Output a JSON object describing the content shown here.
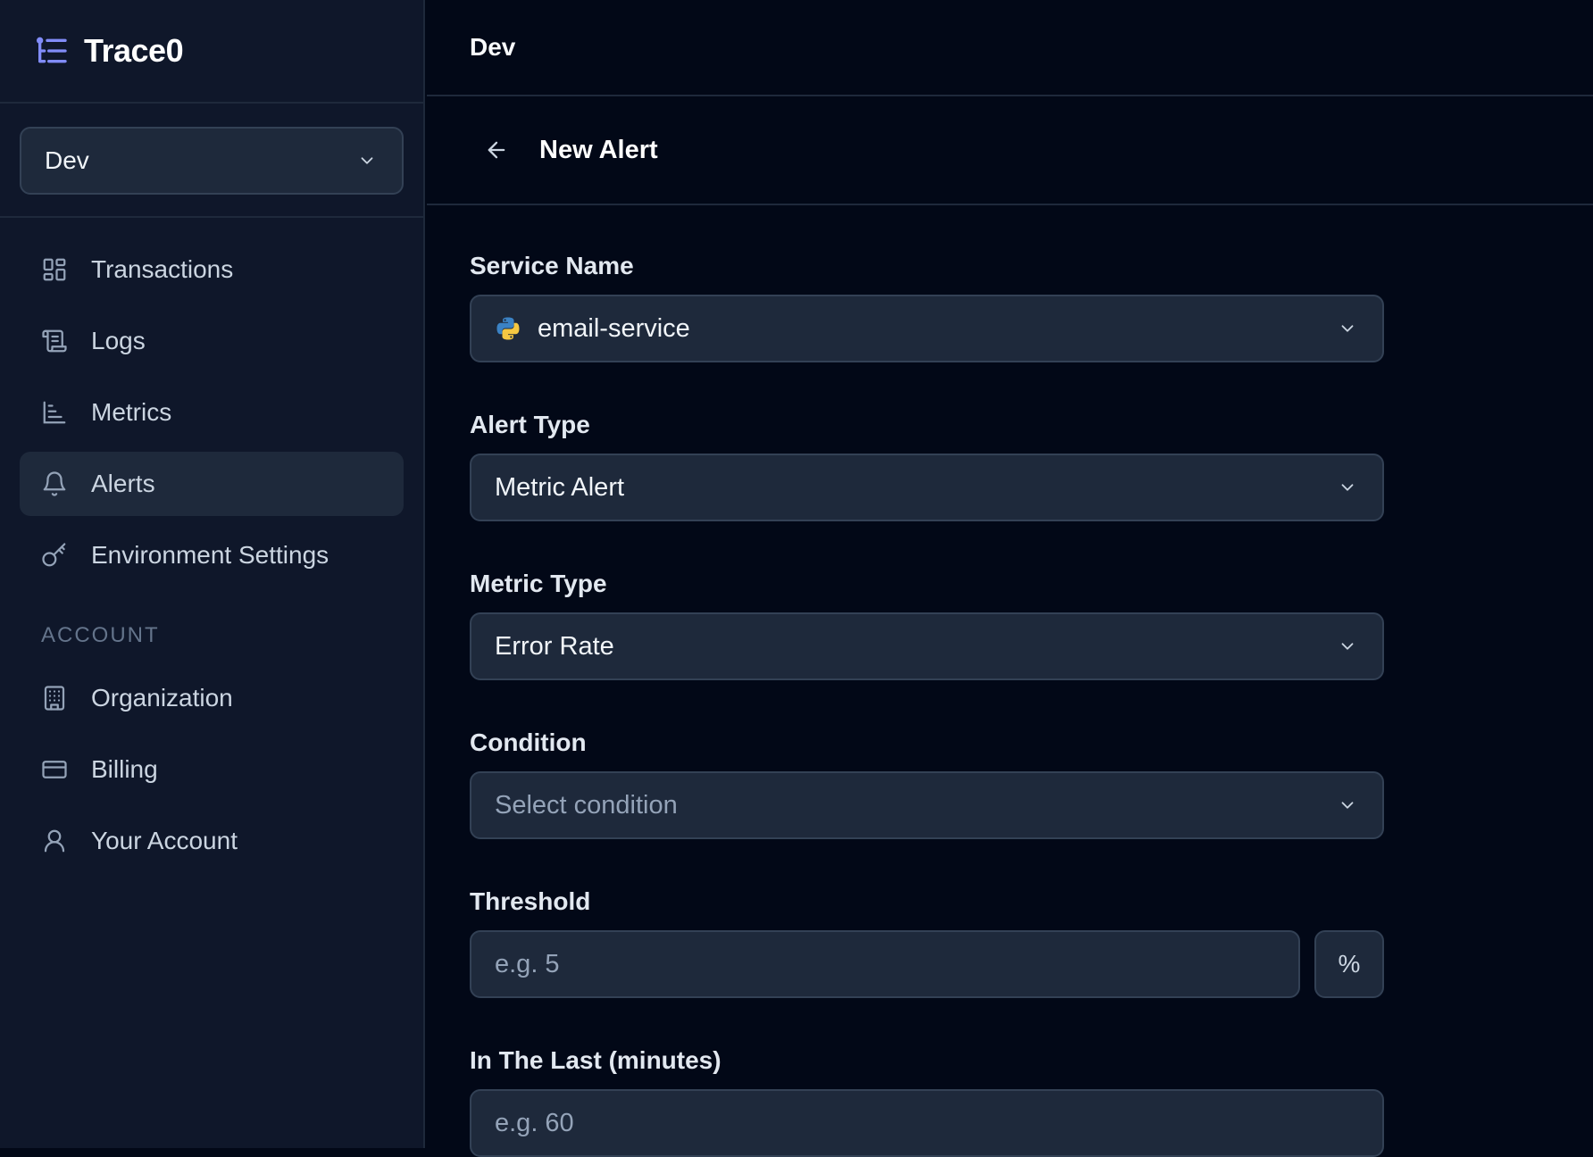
{
  "brand": {
    "name": "Trace0",
    "icon": "list-tree-icon"
  },
  "environment_selector": {
    "value": "Dev"
  },
  "nav": {
    "items": [
      {
        "label": "Transactions",
        "icon": "layout-grid-icon",
        "active": false
      },
      {
        "label": "Logs",
        "icon": "scroll-icon",
        "active": false
      },
      {
        "label": "Metrics",
        "icon": "bar-chart-icon",
        "active": false
      },
      {
        "label": "Alerts",
        "icon": "bell-icon",
        "active": true
      },
      {
        "label": "Environment Settings",
        "icon": "key-icon",
        "active": false
      }
    ],
    "account_section_label": "ACCOUNT",
    "account_items": [
      {
        "label": "Organization",
        "icon": "building-icon"
      },
      {
        "label": "Billing",
        "icon": "credit-card-icon"
      },
      {
        "label": "Your Account",
        "icon": "user-icon"
      }
    ]
  },
  "header": {
    "title": "Dev"
  },
  "page": {
    "title": "New Alert"
  },
  "form": {
    "service_name": {
      "label": "Service Name",
      "value": "email-service",
      "icon": "python-icon"
    },
    "alert_type": {
      "label": "Alert Type",
      "value": "Metric Alert"
    },
    "metric_type": {
      "label": "Metric Type",
      "value": "Error Rate"
    },
    "condition": {
      "label": "Condition",
      "placeholder": "Select condition"
    },
    "threshold": {
      "label": "Threshold",
      "placeholder": "e.g. 5",
      "unit": "%"
    },
    "in_the_last": {
      "label": "In The Last (minutes)",
      "placeholder": "e.g. 60"
    }
  },
  "colors": {
    "background": "#020817",
    "sidebar": "#0f172a",
    "surface": "#1e293b",
    "border": "#334155",
    "brand_accent": "#818cf8"
  }
}
